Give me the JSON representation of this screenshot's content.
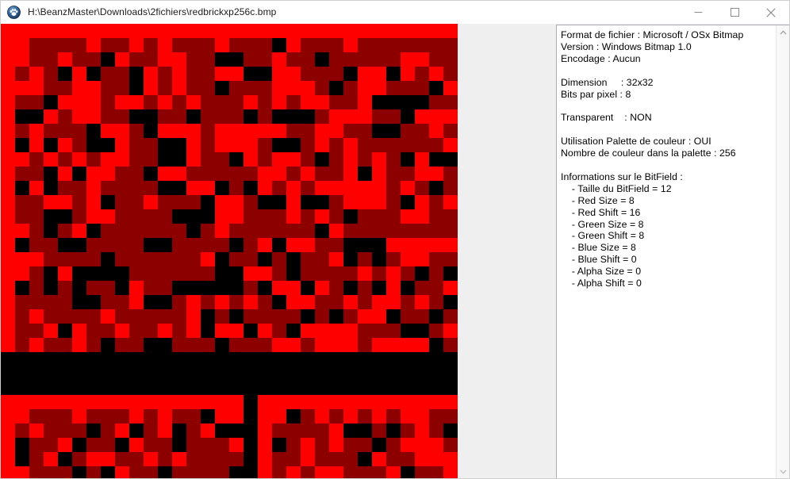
{
  "window": {
    "title": "H:\\BeanzMaster\\Downloads\\2fichiers\\redbrickxp256c.bmp",
    "icon": "paw-print-icon",
    "controls": {
      "minimize": "minimize-icon",
      "maximize": "maximize-icon",
      "close": "close-icon"
    }
  },
  "image_view": {
    "background_color": "#efefef",
    "canvas_background": "#000000",
    "pixel_scale": 18,
    "bitmap_width": 32,
    "bitmap_height": 32,
    "palette": {
      "black": "#000000",
      "bright_red": "#fe0000",
      "dark_red": "#8d0000"
    }
  },
  "info_panel": {
    "lines": [
      "Format de fichier : Microsoft / OSx Bitmap",
      "Version : Windows Bitmap 1.0",
      "Encodage : Aucun",
      "",
      "Dimension     : 32x32",
      "Bits par pixel : 8",
      "",
      "Transparent    : NON",
      "",
      "Utilisation Palette de couleur : OUI",
      "Nombre de couleur dans la palette : 256",
      "",
      "Informations sur le BitField :",
      "    - Taille du BitField = 12",
      "    - Red Size = 8",
      "    - Red Shift = 16",
      "    - Green Size = 8",
      "    - Green Shift = 8",
      "    - Blue Size = 8",
      "    - Blue Shift = 0",
      "    - Alpha Size = 0",
      "    - Alpha Shift = 0"
    ],
    "scrollbar": {
      "up_arrow": "chevron-up-icon",
      "down_arrow": "chevron-down-icon"
    }
  }
}
